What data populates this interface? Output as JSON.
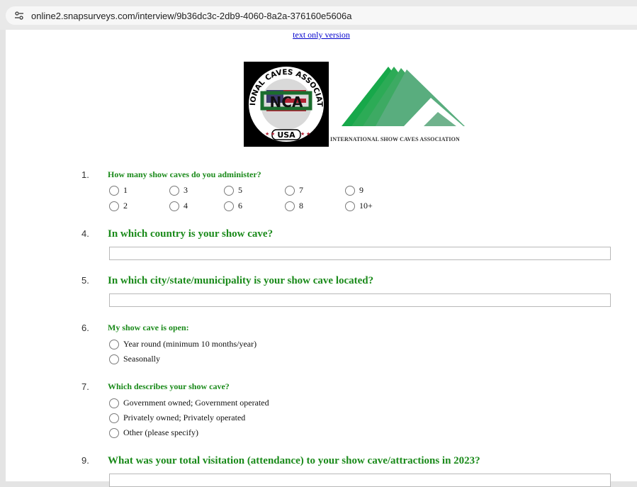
{
  "browser": {
    "url": "online2.snapsurveys.com/interview/9b36dc3c-2db9-4060-8a2a-376160e5606a",
    "site_icon": "tune-icon"
  },
  "page": {
    "text_only_link": "text only version",
    "logo_ncas": {
      "arc_text": "NATIONAL CAVES ASSOCIATION",
      "bottom_text": "USA",
      "monogram": "NCA"
    },
    "logo_isca_caption": "INTERNATIONAL SHOW CAVES ASSOCIATION"
  },
  "questions": {
    "q1": {
      "number": "1.",
      "text": "How many show caves do you administer?",
      "options": [
        "1",
        "3",
        "5",
        "7",
        "9",
        "2",
        "4",
        "6",
        "8",
        "10+"
      ]
    },
    "q4": {
      "number": "4.",
      "text": "In which country is your show cave?"
    },
    "q5": {
      "number": "5.",
      "text": "In which city/state/municipality is your show cave located?"
    },
    "q6": {
      "number": "6.",
      "text": "My show cave is open:",
      "options": [
        "Year round (minimum 10 months/year)",
        "Seasonally"
      ]
    },
    "q7": {
      "number": "7.",
      "text": "Which describes your show cave?",
      "options": [
        "Government owned; Government operated",
        "Privately owned; Privately operated",
        "Other (please specify)"
      ]
    },
    "q9": {
      "number": "9.",
      "text": "What was your total visitation (attendance) to your show cave/attractions in 2023?"
    }
  }
}
